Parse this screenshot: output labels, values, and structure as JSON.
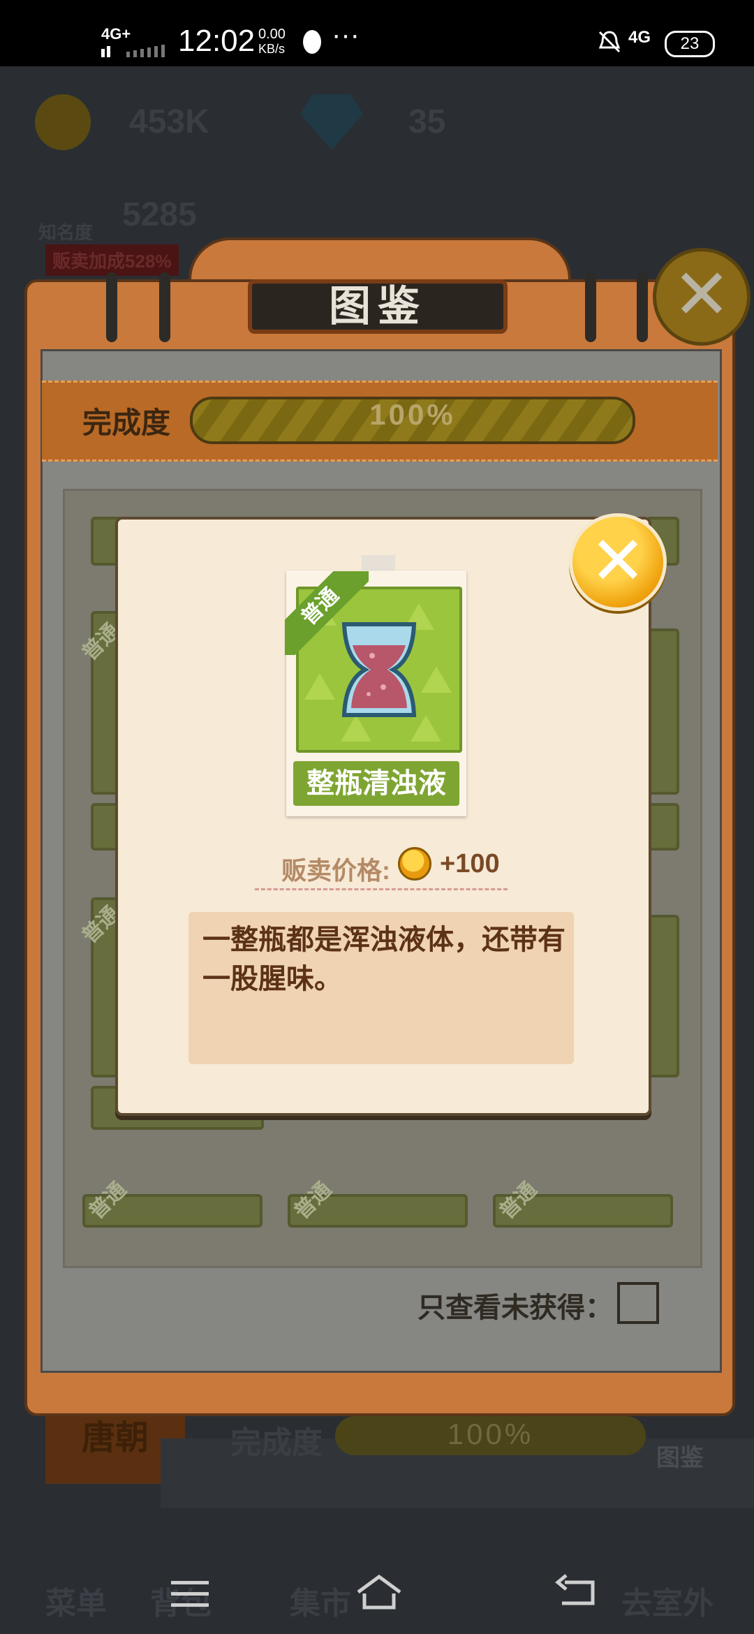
{
  "status_bar": {
    "network_left": "4G+",
    "time": "12:02",
    "speed_value": "0.00",
    "speed_unit": "KB/s",
    "more": "···",
    "network_right": "4G",
    "battery": "23"
  },
  "background": {
    "coins": "453K",
    "gems": "35",
    "fame_label": "知名度",
    "fame_value": "5285",
    "sell_bonus": "贩卖加成528%",
    "dynasty": "唐朝",
    "bottom_progress_label": "完成度",
    "bottom_progress_text": "100%",
    "codex_button": "图鉴",
    "bottom_menu": [
      "菜单",
      "背包",
      "集市",
      "去室外"
    ]
  },
  "codex": {
    "title": "图鉴",
    "progress_label": "完成度",
    "progress_text": "100%",
    "progress_value": 1.0,
    "rarity_badge": "普通",
    "filter_label": "只查看未获得：",
    "filter_checked": false
  },
  "item_popup": {
    "rarity": "普通",
    "name": "整瓶清浊液",
    "price_label": "贩卖价格:",
    "price_value": "+100",
    "description": "一整瓶都是浑浊液体，还带有一股腥味。"
  },
  "colors": {
    "accent_orange": "#c9793c",
    "card_green": "#9bc53d",
    "name_green": "#7ea532",
    "popup_bg": "#f7ead6",
    "close_gold": "#f0a410"
  }
}
